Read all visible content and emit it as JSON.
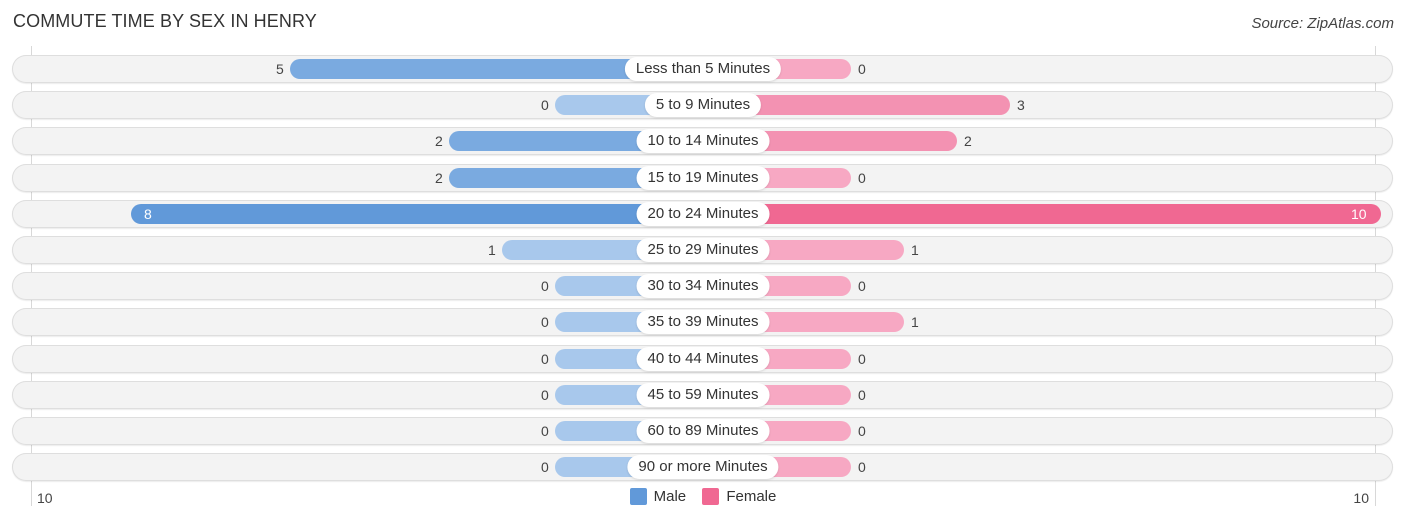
{
  "title": "COMMUTE TIME BY SEX IN HENRY",
  "source": "Source: ZipAtlas.com",
  "colors": {
    "male": "#6199d9",
    "female": "#f06892",
    "male_light": "#a8c8ec",
    "female_light": "#f7a8c3"
  },
  "legend": {
    "male": "Male",
    "female": "Female"
  },
  "axis": {
    "left_label": "10",
    "right_label": "10"
  },
  "chart_data": {
    "type": "bar",
    "orientation": "horizontal-diverging",
    "title": "COMMUTE TIME BY SEX IN HENRY",
    "xlabel": "",
    "ylabel": "",
    "xlim": [
      -10,
      10
    ],
    "legend_position": "bottom-center",
    "categories": [
      "Less than 5 Minutes",
      "5 to 9 Minutes",
      "10 to 14 Minutes",
      "15 to 19 Minutes",
      "20 to 24 Minutes",
      "25 to 29 Minutes",
      "30 to 34 Minutes",
      "35 to 39 Minutes",
      "40 to 44 Minutes",
      "45 to 59 Minutes",
      "60 to 89 Minutes",
      "90 or more Minutes"
    ],
    "series": [
      {
        "name": "Male",
        "values": [
          5,
          0,
          2,
          2,
          8,
          1,
          0,
          0,
          0,
          0,
          0,
          0
        ]
      },
      {
        "name": "Female",
        "values": [
          0,
          3,
          2,
          0,
          10,
          1,
          0,
          1,
          0,
          0,
          0,
          0
        ]
      }
    ]
  }
}
